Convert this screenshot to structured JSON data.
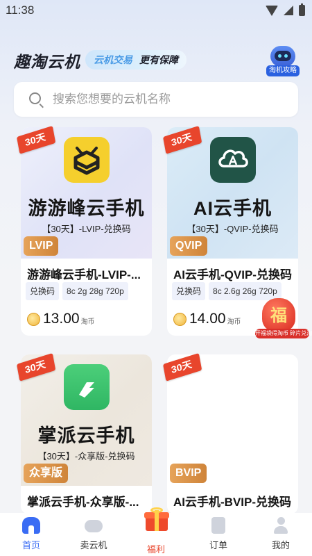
{
  "status_bar": {
    "time": "11:38"
  },
  "header": {
    "brand": "趣淘云机",
    "slogan_1": "云机交易",
    "slogan_2": "更有保障",
    "guide_label": "淘机攻略"
  },
  "search": {
    "placeholder": "搜索您想要的云机名称",
    "value": ""
  },
  "products": [
    {
      "days_tag": "30天",
      "image_title": "游游峰云手机",
      "image_subtitle": "【30天】-LVIP-兑换码",
      "grade": "LVIP",
      "name": "游游峰云手机-LVIP-...",
      "tags": [
        "兑换码",
        "8c 2g 28g 720p"
      ],
      "price": "13.00",
      "unit": "淘币"
    },
    {
      "days_tag": "30天",
      "image_title": "AI云手机",
      "image_subtitle": "【30天】-QVIP-兑换码",
      "grade": "QVIP",
      "name": "AI云手机-QVIP-兑换码",
      "tags": [
        "兑换码",
        "8c 2.6g 26g 720p"
      ],
      "price": "14.00",
      "unit": "淘币"
    },
    {
      "days_tag": "30天",
      "image_title": "掌派云手机",
      "image_subtitle": "【30天】-众享版-兑换码",
      "grade": "众享版",
      "name": "掌派云手机-众享版-..."
    },
    {
      "days_tag": "30天",
      "grade": "BVIP",
      "name": "AI云手机-BVIP-兑换码"
    }
  ],
  "welfare_float": {
    "char": "福",
    "label": "开福袋得淘币 碎片兑淘币"
  },
  "bottom_nav": [
    {
      "label": "首页",
      "icon": "home-icon",
      "active": true
    },
    {
      "label": "卖云机",
      "icon": "cloud-icon",
      "active": false
    },
    {
      "label": "福利",
      "icon": "gift-icon",
      "active": false
    },
    {
      "label": "订单",
      "icon": "order-icon",
      "active": false
    },
    {
      "label": "我的",
      "icon": "profile-icon",
      "active": false
    }
  ],
  "colors": {
    "accent": "#3a6cf4",
    "days_tag": "#e8452c",
    "grade_badge": "#cf8439",
    "tag_bg": "#eef1fb"
  }
}
